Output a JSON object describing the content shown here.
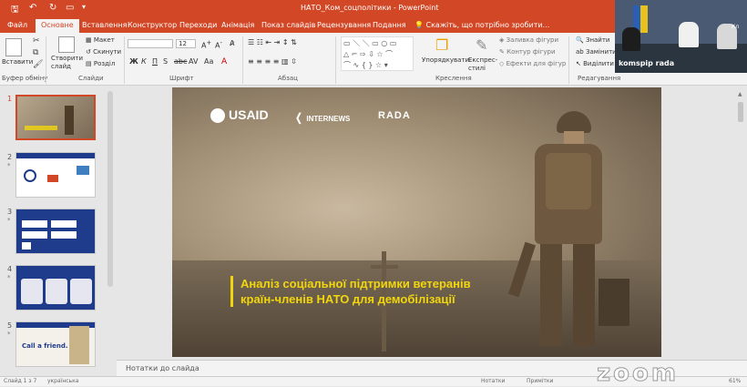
{
  "window": {
    "title": "НАТО_Ком_соцполітики - PowerPoint"
  },
  "tabs": [
    {
      "label": "Файл"
    },
    {
      "label": "Основне"
    },
    {
      "label": "Вставлення"
    },
    {
      "label": "Конструктор"
    },
    {
      "label": "Переходи"
    },
    {
      "label": "Анімація"
    },
    {
      "label": "Показ слайдів"
    },
    {
      "label": "Рецензування"
    },
    {
      "label": "Подання"
    }
  ],
  "tell_me": "Скажіть, що потрібно зробити...",
  "ribbon": {
    "paste": "Вставити",
    "new_slide": "Створити слайд",
    "layout": "Макет",
    "reset": "Скинути",
    "section": "Розділ",
    "font_size": "12",
    "arrange": "Упорядкувати",
    "quick_styles": "Експрес-стилі",
    "shape_fill": "Заливка фігури",
    "shape_outline": "Контур фігури",
    "shape_effects": "Ефекти для фігур",
    "find": "Знайти",
    "replace": "Замінити",
    "select": "Виділити",
    "groups": {
      "clipboard": "Буфер обміну",
      "slides": "Слайди",
      "font": "Шрифт",
      "paragraph": "Абзац",
      "drawing": "Креслення",
      "editing": "Редагування"
    }
  },
  "video": {
    "label": "komspip rada",
    "corner": "Кл"
  },
  "thumbnails": [
    {
      "number": "1",
      "selected": true,
      "star": ""
    },
    {
      "number": "2",
      "selected": false,
      "star": "*"
    },
    {
      "number": "3",
      "selected": false,
      "star": "*"
    },
    {
      "number": "4",
      "selected": false,
      "star": "*"
    },
    {
      "number": "5",
      "selected": false,
      "star": "*"
    }
  ],
  "thumb_texts": {
    "t5_caption": "Call a friend."
  },
  "slide": {
    "logos": [
      "USAID",
      "INTERNEWS",
      "RADA"
    ],
    "title_line1": "Аналіз соціальної підтримки ветеранів",
    "title_line2": "країн-членів НАТО для демобілізації",
    "accent": "#f2d60d"
  },
  "notes_placeholder": "Нотатки до слайда",
  "status": {
    "slide_count": "Слайд 1 з 7",
    "language": "українська",
    "notes": "Нотатки",
    "comments": "Примітки",
    "zoom": "61%"
  },
  "watermark": "zoom",
  "colors": {
    "brand": "#d24726"
  }
}
